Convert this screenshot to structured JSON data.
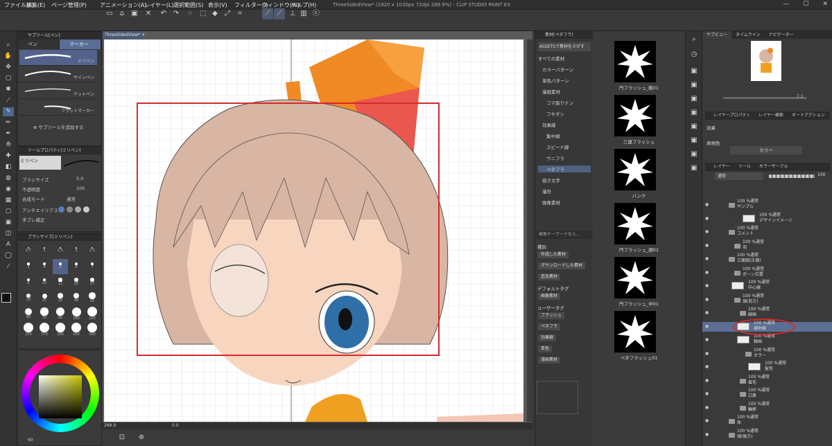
{
  "window": {
    "title": "ThreeSidedView* (1920 x 1030px 72dpi 289.9%) - CLIP STUDIO PAINT EX"
  },
  "menu": [
    "ファイル(F)",
    "編集(E)",
    "ページ管理(P)",
    "アニメーション(A)",
    "レイヤー(L)",
    "選択範囲(S)",
    "表示(V)",
    "フィルター(I)",
    "ウィンドウ(W)",
    "ヘルプ(H)"
  ],
  "subtool": {
    "header": "サブツール[ペン]",
    "tabs": [
      "ペン",
      "マーカー"
    ],
    "brushes": [
      "ミリペン",
      "サインペン",
      "ドットペン",
      "フラットマーカー"
    ],
    "add_label": "サブツールを追加する"
  },
  "toolprop": {
    "header": "ツールプロパティ[ミリペン]",
    "brush_name": "ミリペン",
    "rows": [
      {
        "label": "ブラシサイズ",
        "value": "5.0"
      },
      {
        "label": "不透明度",
        "value": "100"
      },
      {
        "label": "合成モード",
        "value": "通常"
      },
      {
        "label": "アンチエイリアス",
        "value": ""
      },
      {
        "label": "手ブレ補正",
        "value": ""
      }
    ]
  },
  "brushsize": {
    "header": "ブラシサイズ[ミリペン]",
    "sizes": [
      "0.7",
      "1",
      "1.5",
      "2",
      "2.5",
      "3",
      "4",
      "5",
      "6",
      "7",
      "8",
      "10",
      "12",
      "15",
      "17",
      "20",
      "25",
      "30",
      "40",
      "50",
      "60",
      "70",
      "80",
      "100",
      "120",
      "150",
      "170",
      "200",
      "250",
      "300"
    ]
  },
  "canvas": {
    "tab": "ThreeSidedView*",
    "zoom": "289.9",
    "angle": "0.0"
  },
  "material": {
    "header": "素材[ペタフラ]",
    "assets_button": "ASSETSで素材をさがす",
    "tree": [
      "すべての素材",
      "カラーパターン",
      "単色パターン",
      "漫画素材",
      "コマ割りテン",
      "フキダシ",
      "効果線",
      "集中線",
      "スピード線",
      "ウニフラ",
      "ペタフラ",
      "描き文字",
      "漫符",
      "画像素材"
    ],
    "search_placeholder": "検索キーワードを入...",
    "kind_label": "種別",
    "kind_tags": [
      "作成した素材",
      "ダウンロードした素材",
      "追加素材"
    ],
    "default_tag_label": "デフォルトタグ",
    "default_tags": [
      "画像素材"
    ],
    "user_tag_label": "ユーザータグ",
    "user_tags": [
      "フラッシュ",
      "ペタフラ",
      "効果線",
      "単色",
      "漫画素材"
    ]
  },
  "thumbs": [
    "円フラッシュ_粗01",
    "三連フラッシュ",
    "バンク",
    "円フラッシュ_細01",
    "円フラッシュ_中01",
    "ペタフラッシュ01"
  ],
  "navigator": {
    "tabs": [
      "サブビュー",
      "タイムライン",
      "ナビゲーター"
    ],
    "zoom": "7.1",
    "angle": "0.0"
  },
  "layerprop": {
    "tabs": [
      "レイヤープロパティ",
      "レイヤー検索",
      "オートアクション"
    ],
    "effect_label": "効果",
    "color_label": "表現色",
    "color_value": "カラー"
  },
  "layers": {
    "tabs": [
      "レイヤー",
      "ツール",
      "カラーサークル"
    ],
    "blend": "通常",
    "opacity": "100",
    "rows": [
      {
        "pct": "100 %通常",
        "name": "サンプル"
      },
      {
        "pct": "100 %通常",
        "name": "デザインイメージ"
      },
      {
        "pct": "100 %通常",
        "name": "コメント"
      },
      {
        "pct": "100 %通常",
        "name": "羽"
      },
      {
        "pct": "100 %通常",
        "name": "三面図(正面)"
      },
      {
        "pct": "100 %通常",
        "name": "ポーン位置"
      },
      {
        "pct": "100 %通常",
        "name": "中心線"
      },
      {
        "pct": "100 %通常",
        "name": "頭(前方)"
      },
      {
        "pct": "100 %通常",
        "name": "線画"
      },
      {
        "pct": "100 %通常",
        "name": "補助線"
      },
      {
        "pct": "100 %通常",
        "name": "線画"
      },
      {
        "pct": "100 %通常",
        "name": "カラー"
      },
      {
        "pct": "100 %通常",
        "name": "髪色"
      },
      {
        "pct": "100 %通常",
        "name": "眉毛"
      },
      {
        "pct": "100 %通常",
        "name": "口鼻"
      },
      {
        "pct": "100 %通常",
        "name": "輪郭"
      },
      {
        "pct": "100 %通常",
        "name": "体"
      },
      {
        "pct": "100 %通常",
        "name": "頭(後方)"
      }
    ]
  },
  "colors": {
    "accent": "#5c6e94",
    "annotation": "#d42a2a",
    "hair": "#d9b5a3",
    "skin": "#f7d5bf",
    "ribbon": "#f08a24",
    "eye": "#2f6fa8"
  },
  "status": {
    "zoom_value": "60"
  }
}
